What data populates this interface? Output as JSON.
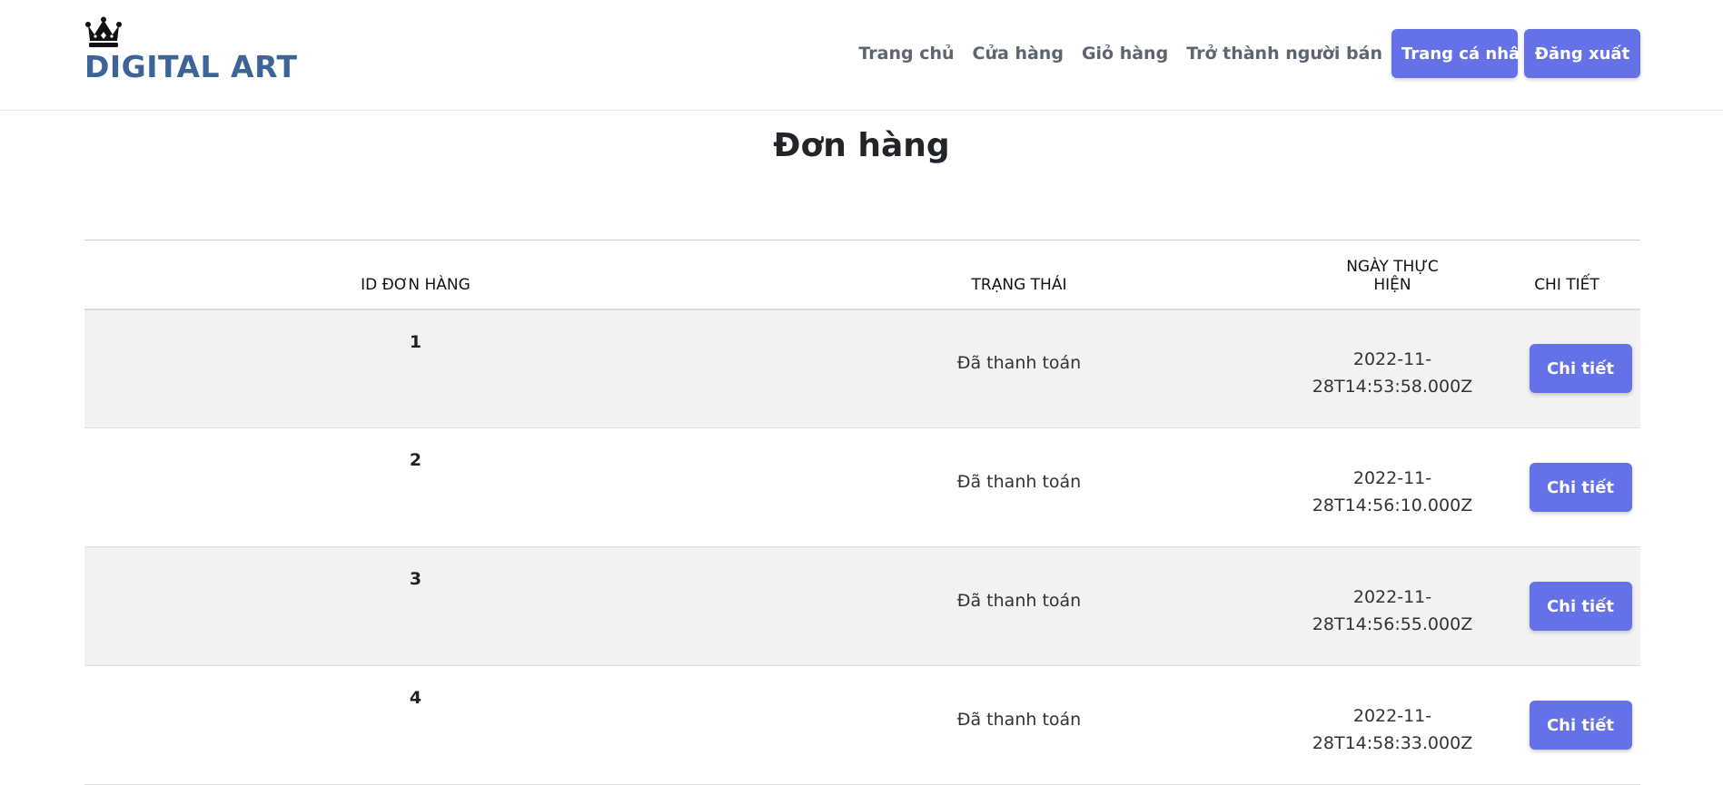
{
  "brand": {
    "name": "DIGITAL ART",
    "icon": "crown-icon",
    "color": "#3c6496"
  },
  "nav": {
    "links": [
      "Trang chủ",
      "Cửa hàng",
      "Giỏ hàng",
      "Trở thành người bán"
    ],
    "profile_button": "Trang cá nhân",
    "logout_button": "Đăng xuất"
  },
  "page_title": "Đơn hàng",
  "table": {
    "headers": {
      "id": "ID ĐƠN HÀNG",
      "status": "TRẠNG THÁI",
      "date_line1": "NGÀY THỰC",
      "date_line2": "HIỆN",
      "detail": "CHI TIẾT"
    },
    "rows": [
      {
        "id": "1",
        "status": "Đã thanh toán",
        "date_line1": "2022-11-",
        "date_line2": "28T14:53:58.000Z",
        "action": "Chi tiết"
      },
      {
        "id": "2",
        "status": "Đã thanh toán",
        "date_line1": "2022-11-",
        "date_line2": "28T14:56:10.000Z",
        "action": "Chi tiết"
      },
      {
        "id": "3",
        "status": "Đã thanh toán",
        "date_line1": "2022-11-",
        "date_line2": "28T14:56:55.000Z",
        "action": "Chi tiết"
      },
      {
        "id": "4",
        "status": "Đã thanh toán",
        "date_line1": "2022-11-",
        "date_line2": "28T14:58:33.000Z",
        "action": "Chi tiết"
      }
    ]
  },
  "colors": {
    "accent": "#6571e6",
    "row_stripe": "#f2f2f2"
  }
}
